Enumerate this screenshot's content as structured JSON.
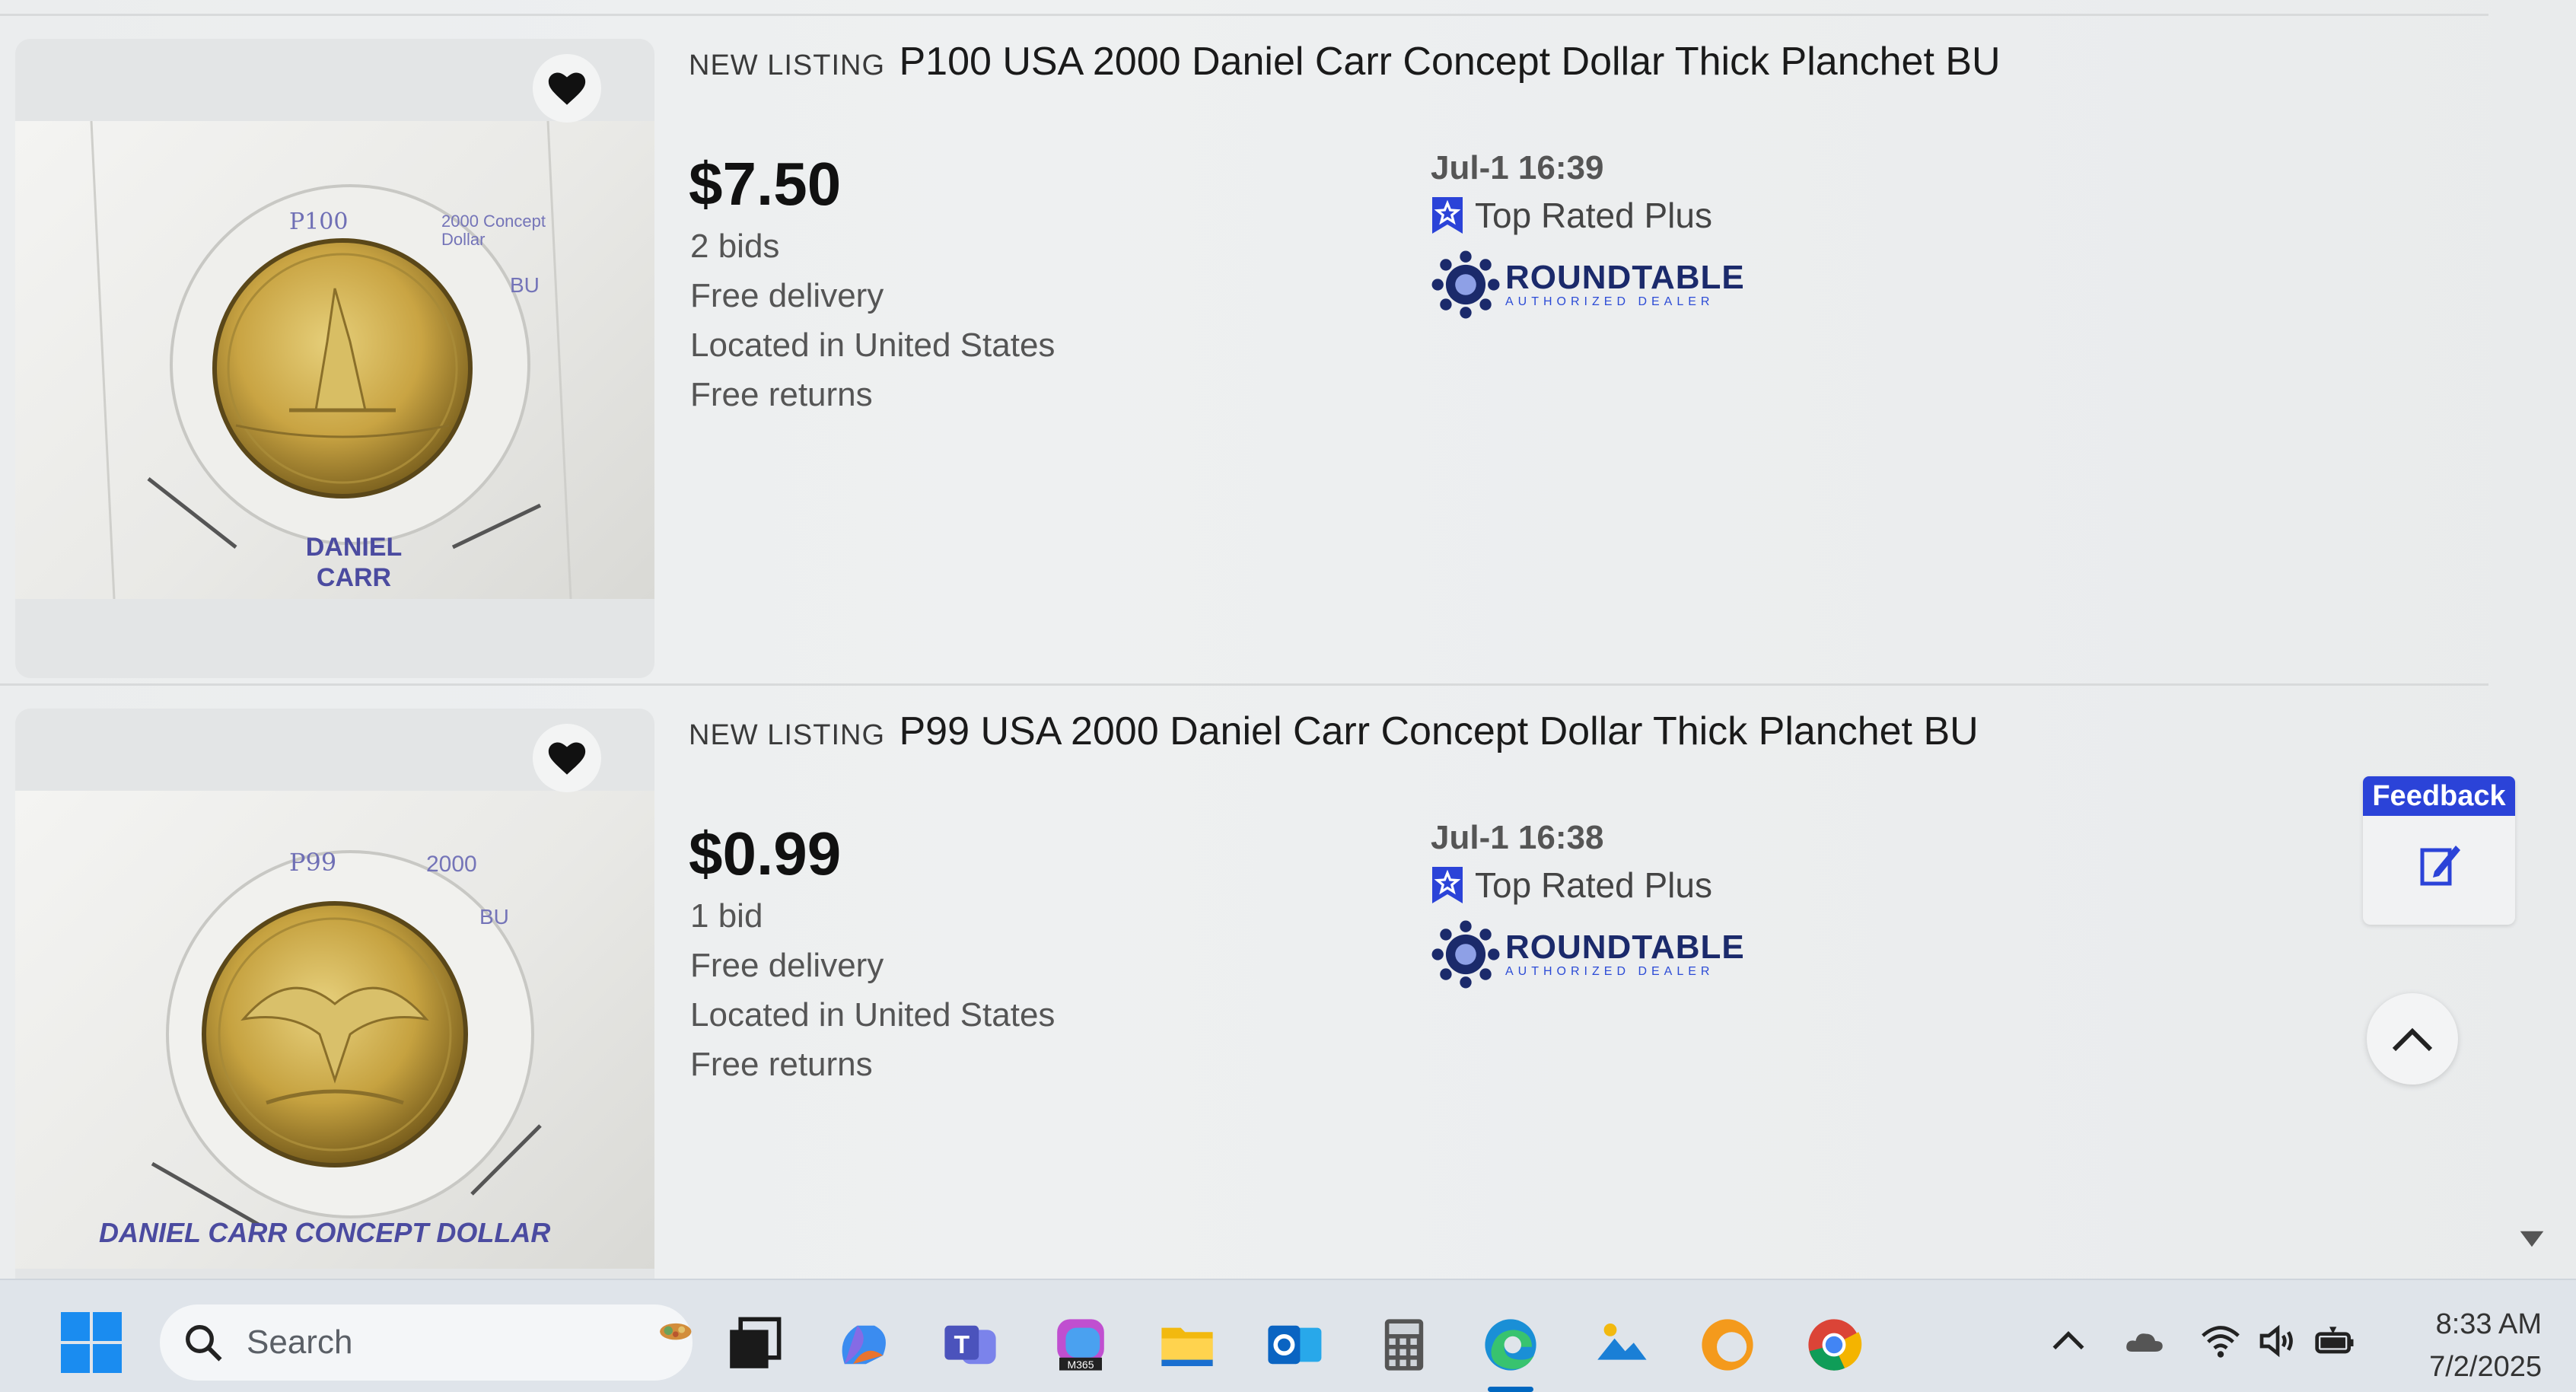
{
  "listings": [
    {
      "badge": "NEW LISTING",
      "title": "P100 USA 2000 Daniel Carr Concept Dollar Thick Planchet BU",
      "price": "$7.50",
      "bids": "2 bids",
      "delivery": "Free delivery",
      "location": "Located in United States",
      "returns": "Free returns",
      "end_time": "Jul-1 16:39",
      "seller_badge": "Top Rated Plus",
      "seller_name": "ROUNDTABLE",
      "seller_tagline": "AUTHORIZED DEALER",
      "photo_notes": {
        "top_left": "P100",
        "top_right": "2000 Concept Dollar",
        "side": "BU",
        "bottom": "DANIEL CARR"
      }
    },
    {
      "badge": "NEW LISTING",
      "title": "P99 USA 2000 Daniel Carr Concept Dollar Thick Planchet BU",
      "price": "$0.99",
      "bids": "1 bid",
      "delivery": "Free delivery",
      "location": "Located in United States",
      "returns": "Free returns",
      "end_time": "Jul-1 16:38",
      "seller_badge": "Top Rated Plus",
      "seller_name": "ROUNDTABLE",
      "seller_tagline": "AUTHORIZED DEALER",
      "photo_notes": {
        "top_left": "P99",
        "top_right": "2000",
        "side": "BU",
        "bottom": "DANIEL CARR CONCEPT DOLLAR"
      }
    }
  ],
  "feedback": {
    "label": "Feedback"
  },
  "taskbar": {
    "search_label": "Search",
    "time": "8:33 AM",
    "date": "7/2/2025",
    "apps": [
      "copilot-icon",
      "teams-icon",
      "m365-icon",
      "file-explorer-icon",
      "outlook-icon",
      "calculator-icon",
      "edge-icon",
      "photos-icon",
      "edge-canary-icon",
      "chrome-icon"
    ]
  },
  "colors": {
    "ebay_blue": "#2b43d8",
    "roundtable_navy": "#1b2a6b",
    "coin_gold": "#c9a443"
  }
}
